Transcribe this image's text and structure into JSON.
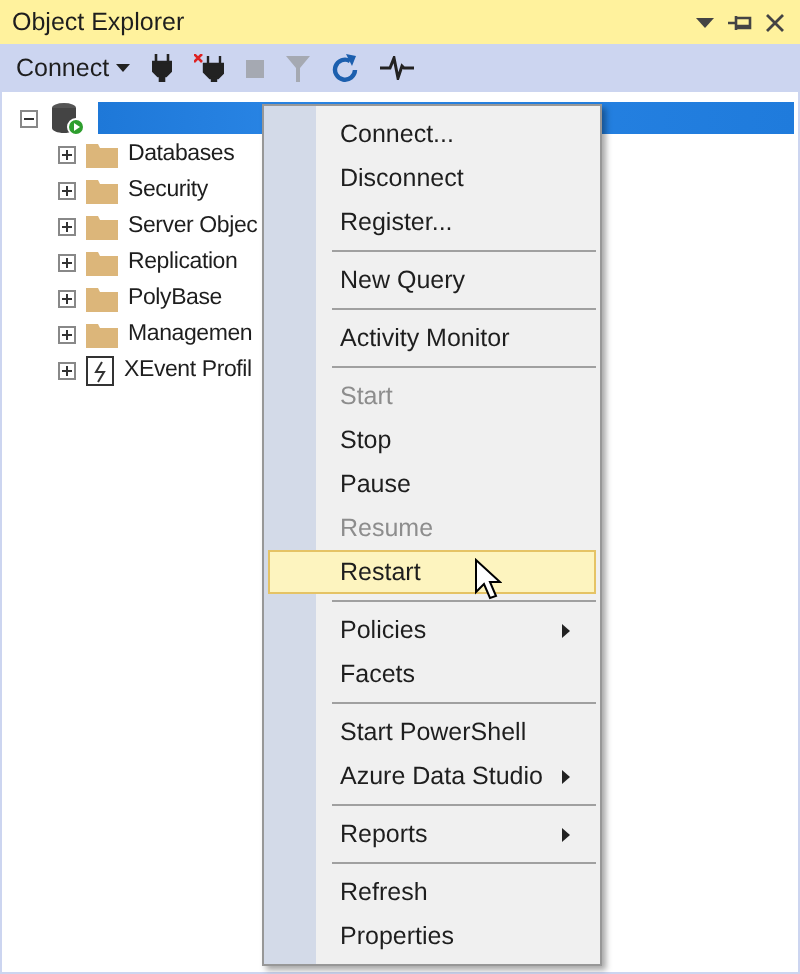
{
  "window": {
    "title": "Object Explorer"
  },
  "toolbar": {
    "connect_label": "Connect"
  },
  "tree": {
    "expanded": true,
    "selected": true,
    "children": [
      {
        "label": "Databases",
        "kind": "folder",
        "expanded": false
      },
      {
        "label": "Security",
        "kind": "folder",
        "expanded": false
      },
      {
        "label": "Server Objec",
        "kind": "folder",
        "expanded": false
      },
      {
        "label": "Replication",
        "kind": "folder",
        "expanded": false
      },
      {
        "label": "PolyBase",
        "kind": "folder",
        "expanded": false
      },
      {
        "label": "Managemen",
        "kind": "folder",
        "expanded": false
      },
      {
        "label": "XEvent Profil",
        "kind": "profiler",
        "expanded": false
      }
    ]
  },
  "context_menu": [
    {
      "kind": "item",
      "label": "Connect...",
      "disabled": false,
      "selected": false,
      "submenu": false
    },
    {
      "kind": "item",
      "label": "Disconnect",
      "disabled": false,
      "selected": false,
      "submenu": false
    },
    {
      "kind": "item",
      "label": "Register...",
      "disabled": false,
      "selected": false,
      "submenu": false
    },
    {
      "kind": "separator"
    },
    {
      "kind": "item",
      "label": "New Query",
      "disabled": false,
      "selected": false,
      "submenu": false
    },
    {
      "kind": "separator"
    },
    {
      "kind": "item",
      "label": "Activity Monitor",
      "disabled": false,
      "selected": false,
      "submenu": false
    },
    {
      "kind": "separator"
    },
    {
      "kind": "item",
      "label": "Start",
      "disabled": true,
      "selected": false,
      "submenu": false
    },
    {
      "kind": "item",
      "label": "Stop",
      "disabled": false,
      "selected": false,
      "submenu": false
    },
    {
      "kind": "item",
      "label": "Pause",
      "disabled": false,
      "selected": false,
      "submenu": false
    },
    {
      "kind": "item",
      "label": "Resume",
      "disabled": true,
      "selected": false,
      "submenu": false
    },
    {
      "kind": "item",
      "label": "Restart",
      "disabled": false,
      "selected": true,
      "submenu": false
    },
    {
      "kind": "separator"
    },
    {
      "kind": "item",
      "label": "Policies",
      "disabled": false,
      "selected": false,
      "submenu": true
    },
    {
      "kind": "item",
      "label": "Facets",
      "disabled": false,
      "selected": false,
      "submenu": false
    },
    {
      "kind": "separator"
    },
    {
      "kind": "item",
      "label": "Start PowerShell",
      "disabled": false,
      "selected": false,
      "submenu": false
    },
    {
      "kind": "item",
      "label": "Azure Data Studio",
      "disabled": false,
      "selected": false,
      "submenu": true
    },
    {
      "kind": "separator"
    },
    {
      "kind": "item",
      "label": "Reports",
      "disabled": false,
      "selected": false,
      "submenu": true
    },
    {
      "kind": "separator"
    },
    {
      "kind": "item",
      "label": "Refresh",
      "disabled": false,
      "selected": false,
      "submenu": false
    },
    {
      "kind": "item",
      "label": "Properties",
      "disabled": false,
      "selected": false,
      "submenu": false
    }
  ]
}
